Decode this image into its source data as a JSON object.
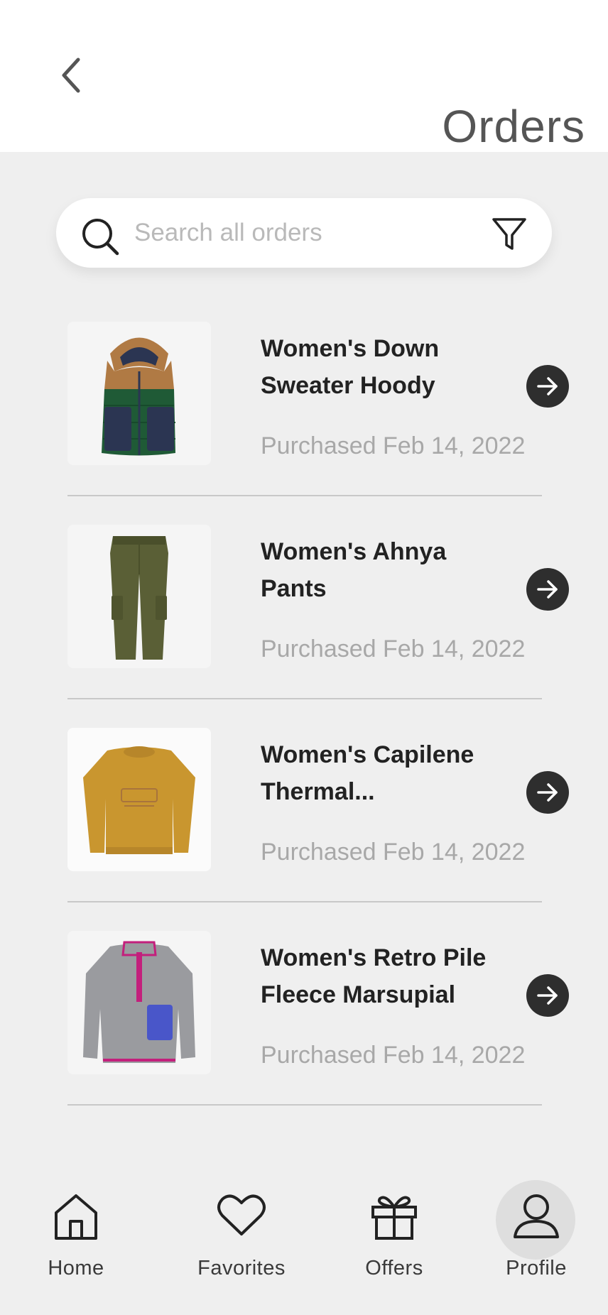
{
  "header": {
    "title": "Orders",
    "back_icon": "chevron-left-icon"
  },
  "search": {
    "placeholder": "Search all orders",
    "value": "",
    "search_icon": "search-icon",
    "filter_icon": "filter-icon"
  },
  "orders": [
    {
      "name": "Women's Down Sweater Hoody",
      "date": "Purchased Feb 14, 2022",
      "image": "down-vest-image"
    },
    {
      "name": "Women's Ahnya Pants",
      "date": "Purchased Feb 14, 2022",
      "image": "olive-pants-image"
    },
    {
      "name": "Women's Capilene Thermal...",
      "date": "Purchased Feb 14, 2022",
      "image": "mustard-sweatshirt-image"
    },
    {
      "name": "Women's Retro Pile Fleece Marsupial",
      "date": "Purchased Feb 14, 2022",
      "image": "grey-fleece-image"
    }
  ],
  "bottom_nav": {
    "items": [
      {
        "label": "Home",
        "icon": "home-icon",
        "active": false
      },
      {
        "label": "Favorites",
        "icon": "heart-icon",
        "active": false
      },
      {
        "label": "Offers",
        "icon": "gift-icon",
        "active": false
      },
      {
        "label": "Profile",
        "icon": "user-icon",
        "active": true
      }
    ]
  },
  "colors": {
    "background": "#efefef",
    "header_bg": "#ffffff",
    "arrow_button": "#2e2e2e",
    "text_primary": "#222222",
    "text_secondary": "#a8a8a8",
    "active_nav_bg": "#dedede"
  }
}
